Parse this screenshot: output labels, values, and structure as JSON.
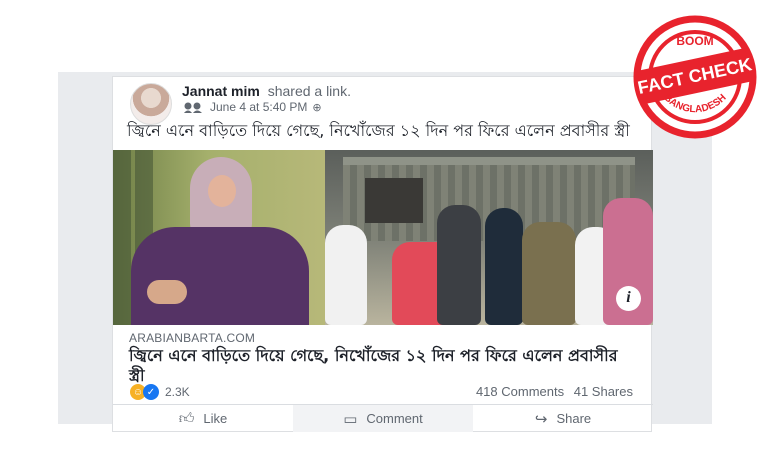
{
  "post": {
    "author_name": "Jannat mim",
    "shared_text": "shared a link.",
    "timestamp": "June 4 at 5:40 PM",
    "body_text": "জ্বিনে এনে বাড়িতে দিয়ে গেছে, নিখোঁজের ১২ দিন পর ফিরে এলেন প্রবাসীর স্ত্রী",
    "link_source": "ARABIANBARTA.COM",
    "link_title": "জ্বিনে এনে বাড়িতে দিয়ে গেছে, নিখোঁজের ১২ দিন পর ফিরে এলেন প্রবাসীর স্ত্রী",
    "info_icon_label": "i"
  },
  "stats": {
    "reaction_count": "2.3K",
    "comments": "418 Comments",
    "shares": "41 Shares"
  },
  "actions": {
    "like": "Like",
    "comment": "Comment",
    "share": "Share"
  },
  "stamp": {
    "top_text": "BOOM",
    "center_text": "FACT CHECK",
    "bottom_text": "BANGLADESH",
    "color": "#e8232d"
  },
  "icons": {
    "avatar": "avatar",
    "globe": "globe-icon",
    "like": "thumbs-up-icon",
    "comment": "comment-bubble-icon",
    "share": "share-arrow-icon",
    "haha": "haha-reaction-icon",
    "like_reaction": "like-reaction-icon"
  },
  "colors": {
    "facebook_text": "#1d2129",
    "secondary_text": "#606770",
    "card_border": "#dddfe2",
    "background": "#e9ebee"
  }
}
